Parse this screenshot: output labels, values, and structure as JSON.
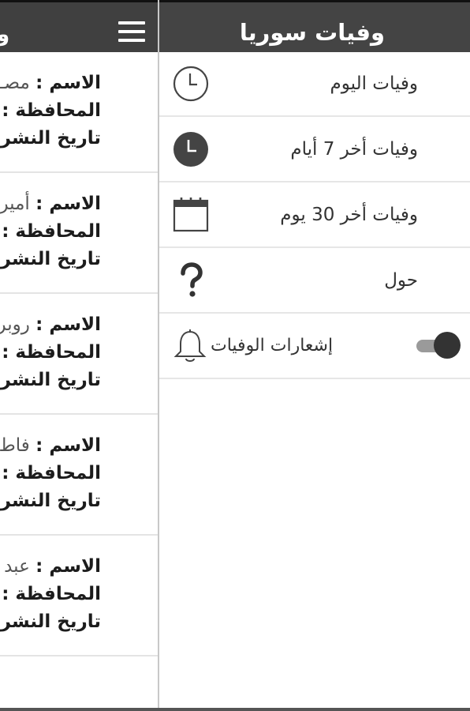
{
  "drawer": {
    "title": "وفيات سوريا",
    "items": [
      {
        "label": "وفيات اليوم",
        "icon": "clock-outline-icon"
      },
      {
        "label": "وفيات أخر 7 أيام",
        "icon": "clock-filled-icon"
      },
      {
        "label": "وفيات أخر 30 يوم",
        "icon": "calendar-icon"
      },
      {
        "label": "حول",
        "icon": "question-icon"
      }
    ],
    "notifications": {
      "label": "إشعارات الوفيات",
      "icon": "bell-icon",
      "enabled": true
    }
  },
  "main": {
    "title_fragment": "و",
    "menu_icon": "hamburger-menu-icon",
    "labels": {
      "name": "الاسم :",
      "province": "المحافظة :",
      "date": "تاريخ النشر:"
    },
    "cards": [
      {
        "name_fragment": "مصـ"
      },
      {
        "name_fragment": "أمير"
      },
      {
        "name_fragment": "روبر"
      },
      {
        "name_fragment": "فاط"
      },
      {
        "name_fragment": "عبد"
      }
    ]
  },
  "colors": {
    "header_bg": "#444444",
    "icon_dark": "#444444",
    "toggle_knob": "#333333",
    "toggle_track": "#9a9a9a"
  }
}
